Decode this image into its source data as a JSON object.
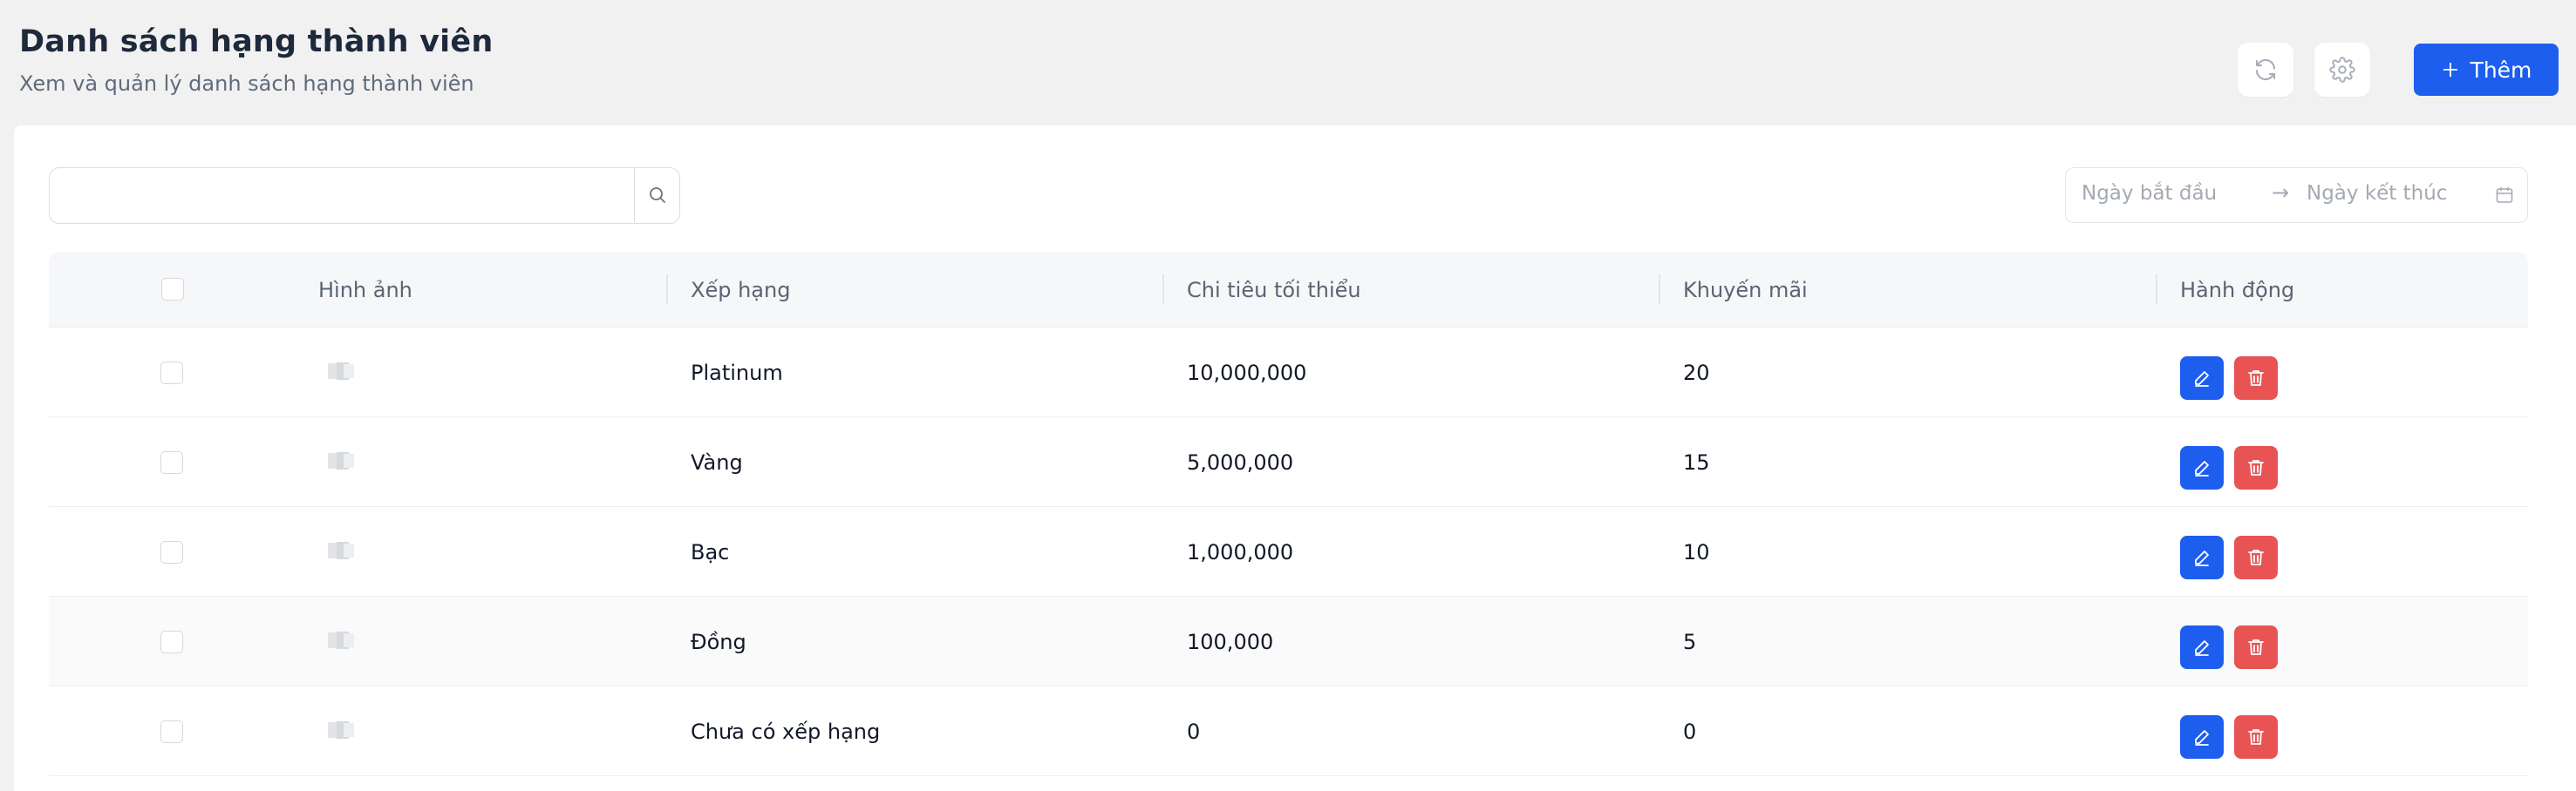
{
  "header": {
    "title": "Danh sách hạng thành viên",
    "subtitle": "Xem và quản lý danh sách hạng thành viên",
    "refresh_icon": "refresh-icon",
    "settings_icon": "gear-icon",
    "add_label": "Thêm"
  },
  "filters": {
    "search_value": "",
    "date_start_placeholder": "Ngày bắt đầu",
    "date_end_placeholder": "Ngày kết thúc",
    "date_arrow": "→"
  },
  "table": {
    "columns": [
      "Hình ảnh",
      "Xếp hạng",
      "Chi tiêu tối thiểu",
      "Khuyến mãi",
      "Hành động"
    ],
    "rows": [
      {
        "rank": "Platinum",
        "min_spend": "10,000,000",
        "promo": "20"
      },
      {
        "rank": "Vàng",
        "min_spend": "5,000,000",
        "promo": "15"
      },
      {
        "rank": "Bạc",
        "min_spend": "1,000,000",
        "promo": "10"
      },
      {
        "rank": "Đồng",
        "min_spend": "100,000",
        "promo": "5"
      },
      {
        "rank": "Chưa có xếp hạng",
        "min_spend": "0",
        "promo": "0"
      }
    ]
  },
  "colors": {
    "primary": "#1d5eef",
    "danger": "#e85454",
    "background": "#f1f1f2"
  }
}
